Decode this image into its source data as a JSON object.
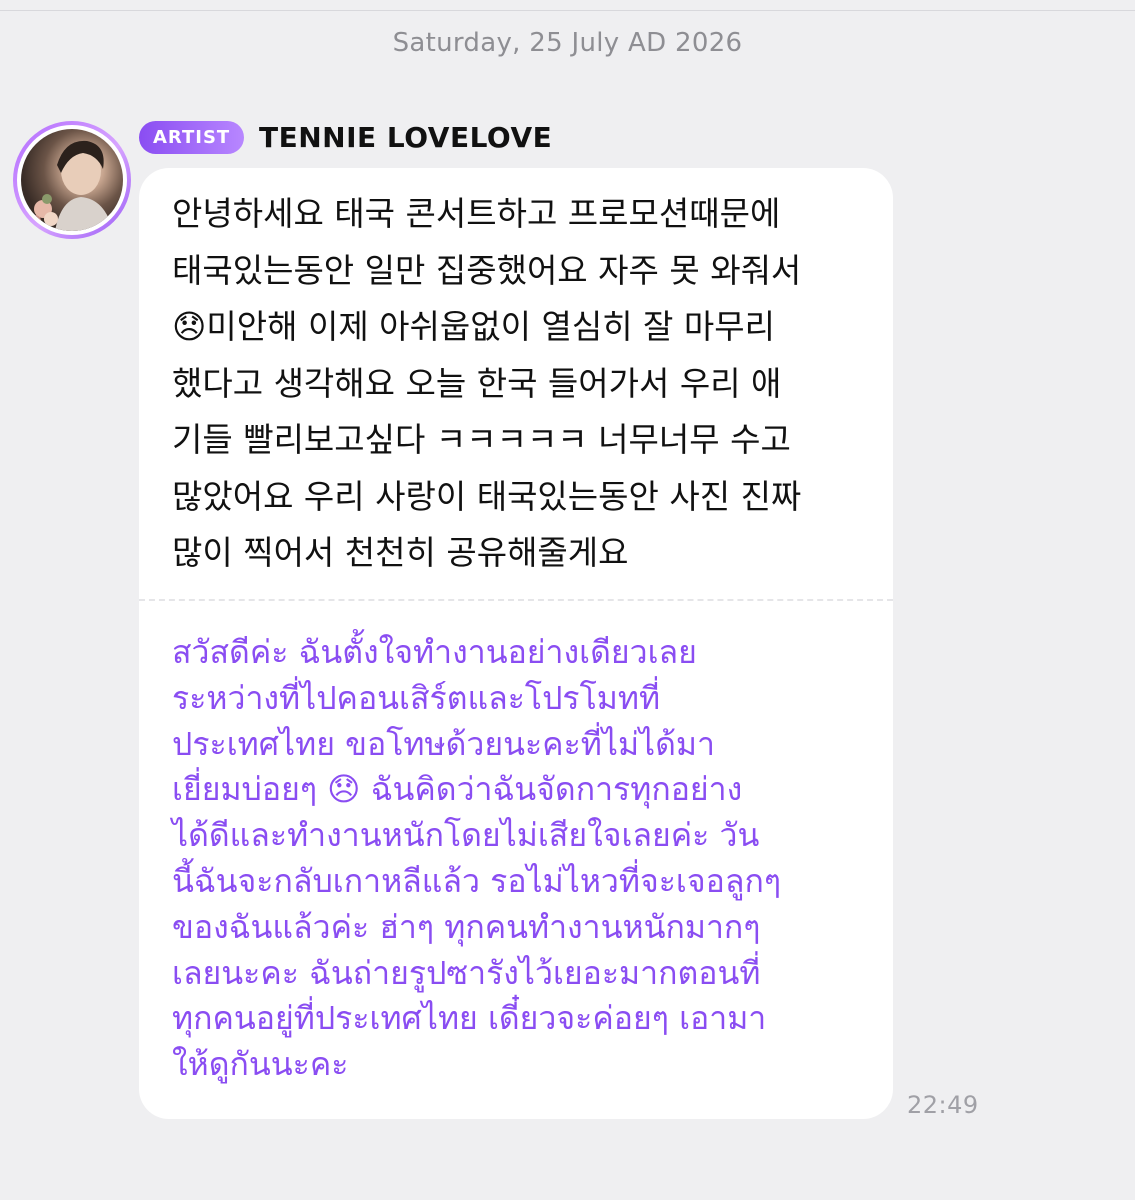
{
  "date_header": "Saturday, 25 July AD 2026",
  "message": {
    "badge": "ARTIST",
    "sender": "TENNIE LOVELOVE",
    "original_lines": [
      "안녕하세요 태국 콘서트하고 프로모션때문에",
      "태국있는동안 일만 집중했어요 자주 못 와줘서",
      "😞미안해 이제 아쉬웁없이 열심히 잘 마무리",
      "했다고 생각해요 오늘 한국 들어가서 우리 애",
      "기들 빨리보고싶다 ㅋㅋㅋㅋㅋ 너무너무 수고",
      "많았어요 우리 사랑이 태국있는동안 사진 진짜",
      "많이 찍어서 천천히 공유해줄게요"
    ],
    "translation_lines": [
      "สวัสดีค่ะ ฉันตั้งใจทำงานอย่างเดียวเลย",
      "ระหว่างที่ไปคอนเสิร์ตและโปรโมทที่",
      "ประเทศไทย ขอโทษด้วยนะคะที่ไม่ได้มา",
      "เยี่ยมบ่อยๆ 😞 ฉันคิดว่าฉันจัดการทุกอย่าง",
      "ได้ดีและทำงานหนักโดยไม่เสียใจเลยค่ะ วัน",
      "นี้ฉันจะกลับเกาหลีแล้ว รอไม่ไหวที่จะเจอลูกๆ",
      "ของฉันแล้วค่ะ ฮ่าๆ ทุกคนทำงานหนักมากๆ",
      "เลยนะคะ ฉันถ่ายรูปซารังไว้เยอะมากตอนที่",
      "ทุกคนอยู่ที่ประเทศไทย เดี๋ยวจะค่อยๆ เอามา",
      "ให้ดูกันนะคะ"
    ],
    "time": "22:49"
  },
  "colors": {
    "background": "#efeff1",
    "bubble": "#ffffff",
    "accent_purple": "#8a4df2",
    "timestamp": "#a0a0a6"
  },
  "icons": {
    "avatar": "artist-profile-photo",
    "emoji": "disappointed-face"
  }
}
